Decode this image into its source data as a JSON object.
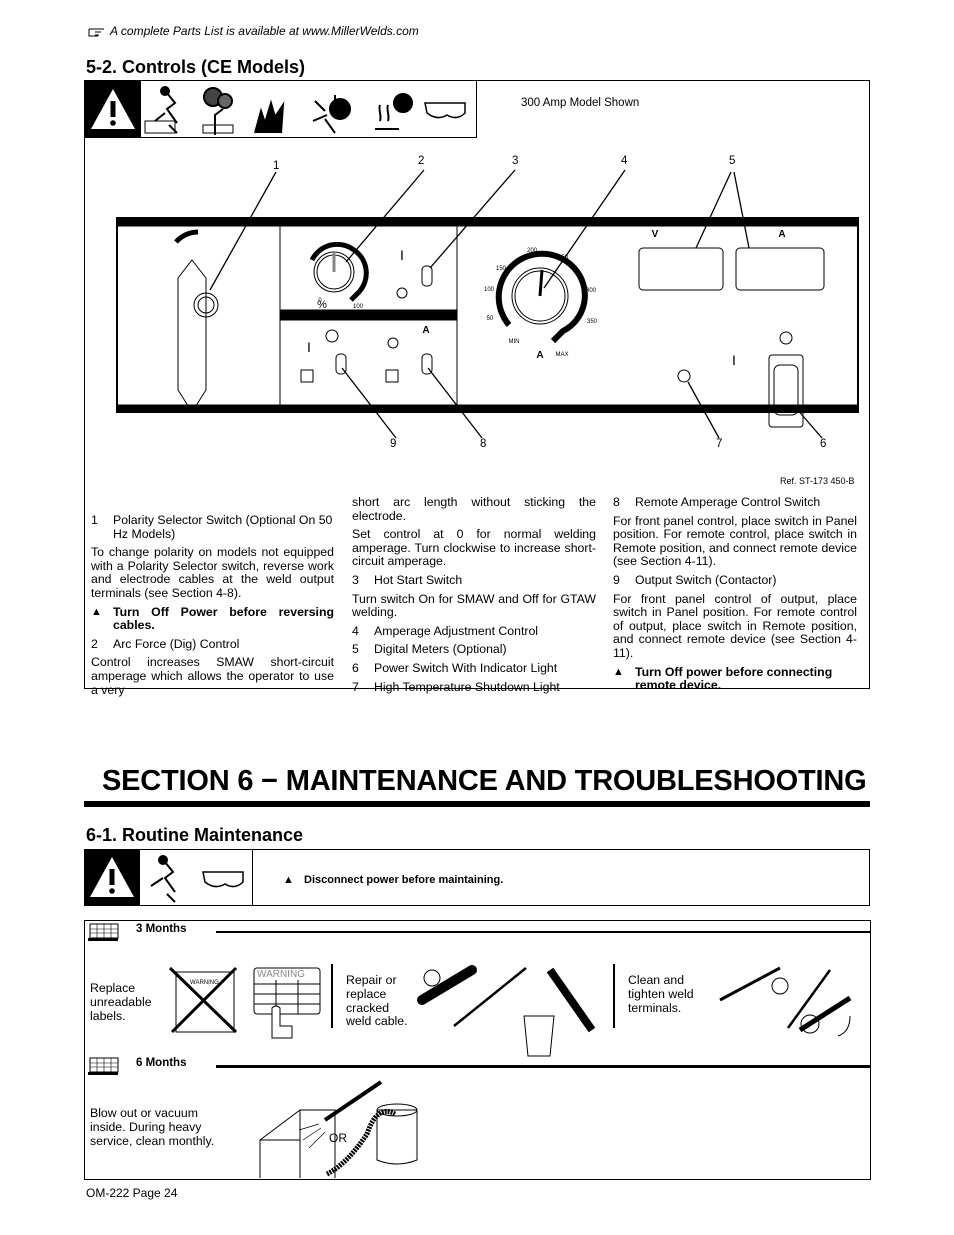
{
  "header_note": {
    "icon": "pointing-hand-icon",
    "text": "A complete Parts List is available at www.MillerWelds.com"
  },
  "controls_section": {
    "title": "5-2.   Controls (CE Models)",
    "model_caption": "300 Amp Model Shown",
    "safety_icons": [
      "warning-triangle-icon",
      "electric-shock-icon",
      "fumes-icon",
      "fire-explosion-icon",
      "arc-rays-icon",
      "hot-parts-icon",
      "safety-glasses-icon"
    ],
    "diagram": {
      "callouts_top": [
        "1",
        "2",
        "3",
        "4",
        "5"
      ],
      "callouts_bottom": [
        "9",
        "8",
        "7",
        "6"
      ],
      "meter_labels": [
        "V",
        "A"
      ],
      "dial_small": {
        "labels": [
          "0",
          "%",
          "100"
        ]
      },
      "dial_large": {
        "ticks": [
          "50",
          "100",
          "150",
          "200",
          "250",
          "300",
          "350"
        ],
        "min": "MIN",
        "max": "MAX",
        "unit": "A"
      },
      "switch_labels": [
        "I",
        "I",
        "A",
        "I"
      ],
      "reference": "Ref. ST-173 450-B"
    },
    "columns": {
      "c1": {
        "i1_num": "1",
        "i1": "Polarity Selector Switch (Optional On 50 Hz Models)",
        "p1": "To change polarity on models not equipped with a Polarity Selector switch, reverse work and electrode cables at the weld output terminals (see Section 4-8).",
        "w1": "Turn Off Power before reversing cables.",
        "i2_num": "2",
        "i2": "Arc Force (Dig) Control",
        "p2": "Control increases SMAW short-circuit amperage which allows the operator to use a very"
      },
      "c2": {
        "p1": "short arc length without sticking the electrode.",
        "p2": "Set control at 0 for normal welding amperage. Turn clockwise to increase short-circuit amperage.",
        "i3_num": "3",
        "i3": "Hot Start Switch",
        "p3": "Turn switch On for SMAW and Off for GTAW welding.",
        "i4_num": "4",
        "i4": "Amperage Adjustment Control",
        "i5_num": "5",
        "i5": "Digital Meters (Optional)",
        "i6_num": "6",
        "i6": "Power Switch With Indicator Light",
        "i7_num": "7",
        "i7": "High Temperature Shutdown Light"
      },
      "c3": {
        "i8_num": "8",
        "i8": "Remote Amperage Control Switch",
        "p1": "For front panel control, place switch in Panel position. For remote control, place switch in Remote position, and connect remote device (see Section 4-11).",
        "i9_num": "9",
        "i9": "Output Switch (Contactor)",
        "p2": "For front panel control of output, place switch in Panel position. For remote control of output, place switch in Remote position, and connect remote device (see Section 4-11).",
        "w1": "Turn Off power before connecting remote device."
      }
    }
  },
  "section6": {
    "title": "SECTION 6 − MAINTENANCE AND TROUBLESHOOTING",
    "routine": {
      "title": "6-1.   Routine Maintenance",
      "warning_marker": "▲",
      "warning": "Disconnect power before maintaining.",
      "three_months": {
        "heading": "3 Months",
        "tasks": [
          "Replace unreadable labels.",
          "Repair or replace cracked weld cable.",
          "Clean and tighten weld terminals."
        ],
        "label_text": "WARNING",
        "label_small": "WARNING"
      },
      "six_months": {
        "heading": "6 Months",
        "task": "Blow out or vacuum inside. During heavy service, clean monthly.",
        "or_text": "OR"
      }
    }
  },
  "footer": {
    "page": "OM-222 Page 24"
  }
}
